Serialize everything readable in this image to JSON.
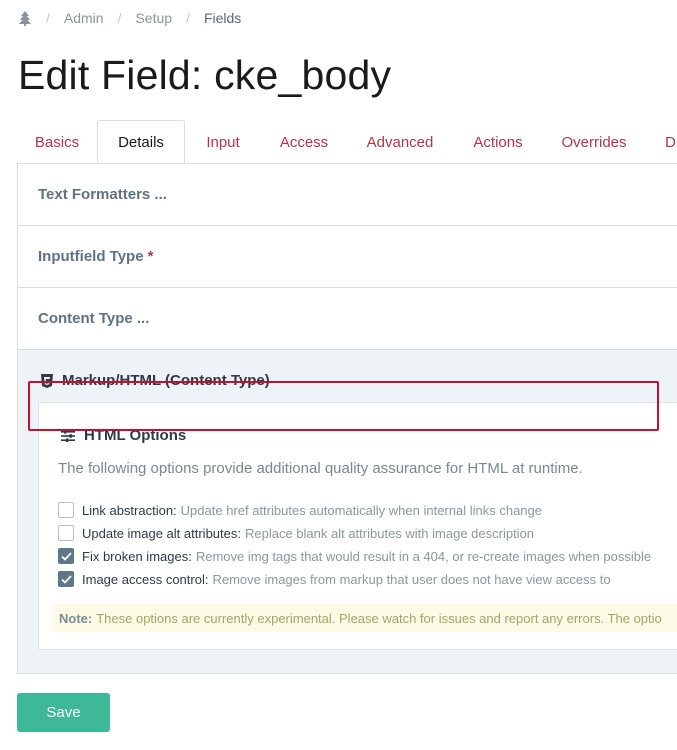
{
  "breadcrumb": {
    "icon": "tree-icon",
    "items": [
      "Admin",
      "Setup",
      "Fields"
    ]
  },
  "page_title": "Edit Field: cke_body",
  "tabs": [
    "Basics",
    "Details",
    "Input",
    "Access",
    "Advanced",
    "Actions",
    "Overrides",
    "D"
  ],
  "active_tab": "Details",
  "rows": {
    "text_formatters": "Text Formatters ...",
    "inputfield_type": "Inputfield Type",
    "required_mark": "*",
    "content_type": "Content Type ..."
  },
  "fieldset": {
    "title": "Markup/HTML (Content Type)",
    "inner_title": "HTML Options",
    "description": "The following options provide additional quality assurance for HTML at runtime.",
    "options": [
      {
        "label": "Link abstraction:",
        "hint": "Update href attributes automatically when internal links change",
        "checked": false
      },
      {
        "label": "Update image alt attributes:",
        "hint": "Replace blank alt attributes with image description",
        "checked": false
      },
      {
        "label": "Fix broken images:",
        "hint": "Remove img tags that would result in a 404, or re-create images when possible",
        "checked": true
      },
      {
        "label": "Image access control:",
        "hint": "Remove images from markup that user does not have view access to",
        "checked": true
      }
    ],
    "note_label": "Note:",
    "note_text": "These options are currently experimental. Please watch for issues and report any errors. The optio"
  },
  "save_label": "Save",
  "colors": {
    "tab_text": "#b8334a",
    "save_button": "#3eb998",
    "highlight_border": "#c8102e",
    "checkbox_checked": "#5f7789",
    "note_bg": "#fbfbe6"
  }
}
